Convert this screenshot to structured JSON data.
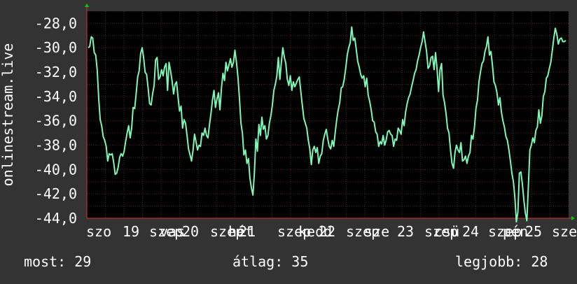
{
  "chart_data": {
    "type": "line",
    "ylabel": "onlinestream.live",
    "ylim": [
      -44,
      -27
    ],
    "y_ticks": [
      "-28,0",
      "-30,0",
      "-32,0",
      "-34,0",
      "-36,0",
      "-38,0",
      "-40,0",
      "-42,0",
      "-44,0"
    ],
    "x_tick_labels": [
      "szo 19 szept",
      "20 szept",
      "21 szept",
      "22 szept",
      "23 szept",
      "24 szept",
      "25 szept"
    ],
    "x_tick_labels_overlap": [
      "szo",
      "19",
      "szep",
      "20",
      "szep",
      "21",
      "szep",
      "22",
      "szep",
      "23",
      "szep",
      "24",
      "szep",
      "25",
      "sze",
      "vas",
      "hét",
      "kedd",
      "sze",
      "csü",
      "pén",
      "szo"
    ],
    "grid": true,
    "colors": {
      "background": "#333333",
      "plot_bg": "#000000",
      "grid": "#4a2a2a",
      "line": "#7ff5b8",
      "axis_arrow": "#00cc00"
    },
    "series": [
      {
        "values": [
          -30.0,
          -29.9,
          -29.1,
          -29.2,
          -30.4,
          -30.6,
          -31.8,
          -34.2,
          -35.9,
          -36.4,
          -37.3,
          -37.6,
          -38.1,
          -39.3,
          -38.7,
          -38.8,
          -38.7,
          -39.4,
          -40.4,
          -40.3,
          -39.8,
          -39.0,
          -38.7,
          -38.9,
          -38.5,
          -37.7,
          -37.0,
          -36.4,
          -37.4,
          -36.6,
          -34.9,
          -35.0,
          -33.8,
          -32.4,
          -31.9,
          -30.5,
          -30.0,
          -30.8,
          -32.0,
          -32.2,
          -33.3,
          -34.6,
          -34.7,
          -33.8,
          -33.1,
          -31.0,
          -30.8,
          -32.6,
          -32.4,
          -31.8,
          -32.3,
          -31.6,
          -31.3,
          -33.5,
          -31.2,
          -31.9,
          -32.7,
          -33.8,
          -33.0,
          -32.8,
          -34.1,
          -35.2,
          -34.8,
          -36.6,
          -35.9,
          -36.2,
          -37.2,
          -38.3,
          -38.8,
          -39.3,
          -38.4,
          -37.1,
          -37.7,
          -38.4,
          -38.0,
          -38.1,
          -37.0,
          -37.2,
          -36.6,
          -37.2,
          -37.4,
          -36.3,
          -35.4,
          -34.3,
          -33.5,
          -34.9,
          -34.2,
          -33.7,
          -35.1,
          -33.3,
          -32.1,
          -32.7,
          -31.2,
          -31.9,
          -31.4,
          -30.9,
          -31.6,
          -31.2,
          -30.2,
          -31.2,
          -32.4,
          -34.1,
          -36.2,
          -37.0,
          -38.8,
          -38.4,
          -39.5,
          -39.1,
          -40.7,
          -41.5,
          -42.1,
          -40.3,
          -37.5,
          -38.5,
          -36.3,
          -37.2,
          -35.7,
          -36.7,
          -36.4,
          -37.5,
          -37.2,
          -36.2,
          -35.6,
          -34.7,
          -33.5,
          -33.0,
          -32.3,
          -30.8,
          -32.6,
          -31.2,
          -30.0,
          -30.8,
          -31.3,
          -32.6,
          -33.1,
          -32.3,
          -33.5,
          -32.8,
          -33.2,
          -32.9,
          -32.6,
          -32.4,
          -33.6,
          -34.7,
          -35.8,
          -36.2,
          -36.6,
          -37.6,
          -38.3,
          -39.6,
          -38.4,
          -38.1,
          -38.6,
          -38.2,
          -39.5,
          -38.9,
          -38.7,
          -37.6,
          -37.1,
          -36.7,
          -37.5,
          -38.1,
          -38.3,
          -37.6,
          -38.1,
          -36.9,
          -35.9,
          -35.1,
          -34.5,
          -33.3,
          -33.2,
          -32.6,
          -31.7,
          -30.6,
          -30.0,
          -29.6,
          -28.3,
          -29.4,
          -29.2,
          -30.1,
          -31.1,
          -31.6,
          -32.2,
          -32.5,
          -32.3,
          -33.2,
          -32.5,
          -33.9,
          -34.4,
          -35.1,
          -36.0,
          -36.1,
          -36.9,
          -37.1,
          -38.1,
          -37.7,
          -37.9,
          -37.2,
          -38.0,
          -37.6,
          -36.9,
          -36.8,
          -37.1,
          -37.2,
          -38.1,
          -37.5,
          -37.6,
          -36.6,
          -36.8,
          -37.1,
          -35.9,
          -36.4,
          -35.3,
          -34.6,
          -34.1,
          -33.8,
          -33.2,
          -32.7,
          -32.1,
          -31.8,
          -31.1,
          -30.6,
          -30.0,
          -29.5,
          -28.7,
          -29.5,
          -30.3,
          -31.7,
          -31.5,
          -30.8,
          -30.7,
          -31.8,
          -30.4,
          -31.7,
          -33.6,
          -31.8,
          -31.3,
          -33.9,
          -34.5,
          -35.4,
          -36.6,
          -37.0,
          -38.4,
          -39.5,
          -39.9,
          -38.6,
          -38.0,
          -38.4,
          -38.6,
          -37.8,
          -39.3,
          -39.2,
          -38.9,
          -39.5,
          -38.9,
          -38.6,
          -37.2,
          -37.5,
          -36.5,
          -35.0,
          -34.3,
          -32.8,
          -32.0,
          -31.3,
          -31.1,
          -30.3,
          -29.9,
          -29.1,
          -30.6,
          -30.3,
          -31.4,
          -32.8,
          -33.1,
          -33.7,
          -34.7,
          -34.1,
          -35.3,
          -36.0,
          -36.5,
          -37.3,
          -37.6,
          -38.4,
          -39.3,
          -40.3,
          -41.0,
          -42.3,
          -44.3,
          -43.5,
          -40.3,
          -40.2,
          -41.2,
          -42.5,
          -43.6,
          -44.2,
          -41.3,
          -38.4,
          -38.0,
          -37.4,
          -37.8,
          -36.8,
          -36.5,
          -35.1,
          -36.2,
          -35.6,
          -34.0,
          -33.6,
          -32.5,
          -32.3,
          -31.7,
          -31.2,
          -30.2,
          -29.2,
          -28.4,
          -28.9,
          -29.7,
          -29.3,
          -29.2,
          -29.5,
          -29.5,
          -29.4
        ]
      }
    ]
  },
  "stats": {
    "now": "most: 29",
    "avg": "átlag: 35",
    "best": "legjobb: 28"
  }
}
